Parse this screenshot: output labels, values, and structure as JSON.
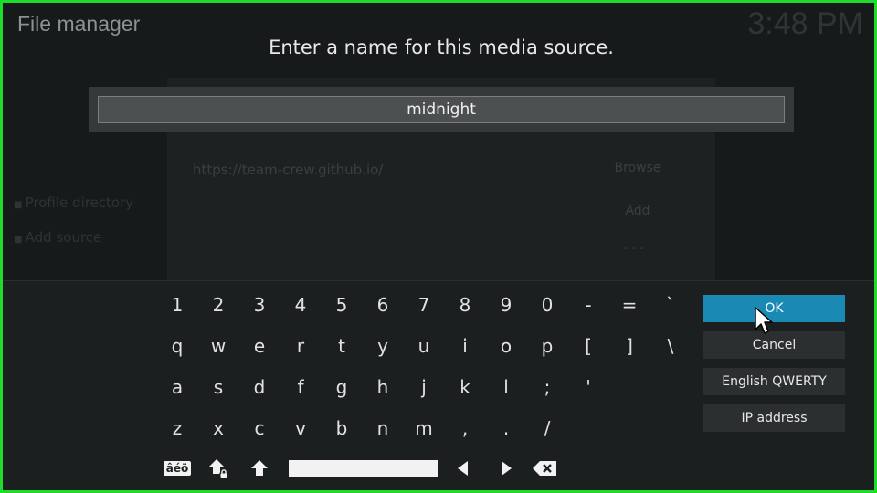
{
  "background": {
    "title": "File manager",
    "clock": "3:48 PM",
    "url": "https://team-crew.github.io/",
    "buttons": [
      "Browse",
      "Add",
      "· · · ·"
    ],
    "side_items": [
      "Profile directory",
      "Add source"
    ]
  },
  "dialog": {
    "heading": "Enter a name for this media source.",
    "input_value": "midnight"
  },
  "keyboard": {
    "rows": [
      [
        "1",
        "2",
        "3",
        "4",
        "5",
        "6",
        "7",
        "8",
        "9",
        "0",
        "-",
        "=",
        "`"
      ],
      [
        "q",
        "w",
        "e",
        "r",
        "t",
        "y",
        "u",
        "i",
        "o",
        "p",
        "[",
        "]",
        "\\"
      ],
      [
        "a",
        "s",
        "d",
        "f",
        "g",
        "h",
        "j",
        "k",
        "l",
        ";",
        "'"
      ],
      [
        "z",
        "x",
        "c",
        "v",
        "b",
        "n",
        "m",
        ",",
        ".",
        "/"
      ]
    ],
    "accent_label": "âéö"
  },
  "buttons": {
    "ok": "OK",
    "cancel": "Cancel",
    "layout": "English QWERTY",
    "ip": "IP address"
  },
  "colors": {
    "focus": "#1a8ab5",
    "frame": "#1fdc2a"
  }
}
